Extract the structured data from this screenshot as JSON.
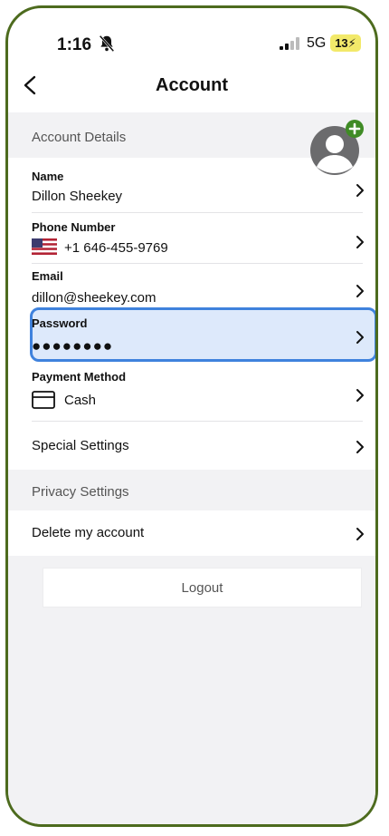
{
  "status_bar": {
    "time": "1:16",
    "network": "5G",
    "battery": "13"
  },
  "header": {
    "title": "Account"
  },
  "sections": {
    "account_details": "Account Details",
    "privacy_settings": "Privacy Settings"
  },
  "fields": {
    "name": {
      "label": "Name",
      "value": "Dillon Sheekey"
    },
    "phone": {
      "label": "Phone Number",
      "value": "+1 646-455-9769"
    },
    "email": {
      "label": "Email",
      "value": "dillon@sheekey.com"
    },
    "password": {
      "label": "Password",
      "value": "●●●●●●●●"
    },
    "payment": {
      "label": "Payment Method",
      "value": "Cash"
    },
    "special": {
      "label": "Special Settings"
    },
    "delete": {
      "label": "Delete my account"
    }
  },
  "logout_label": "Logout",
  "colors": {
    "accent_green": "#4d6b1e",
    "highlight_blue": "#3f82dd",
    "avatar_plus": "#3f8b25"
  },
  "icons": [
    "back-chevron-icon",
    "bell-slash-icon",
    "signal-icon",
    "avatar-icon",
    "plus-icon",
    "us-flag-icon",
    "credit-card-icon",
    "chevron-right-icon"
  ]
}
